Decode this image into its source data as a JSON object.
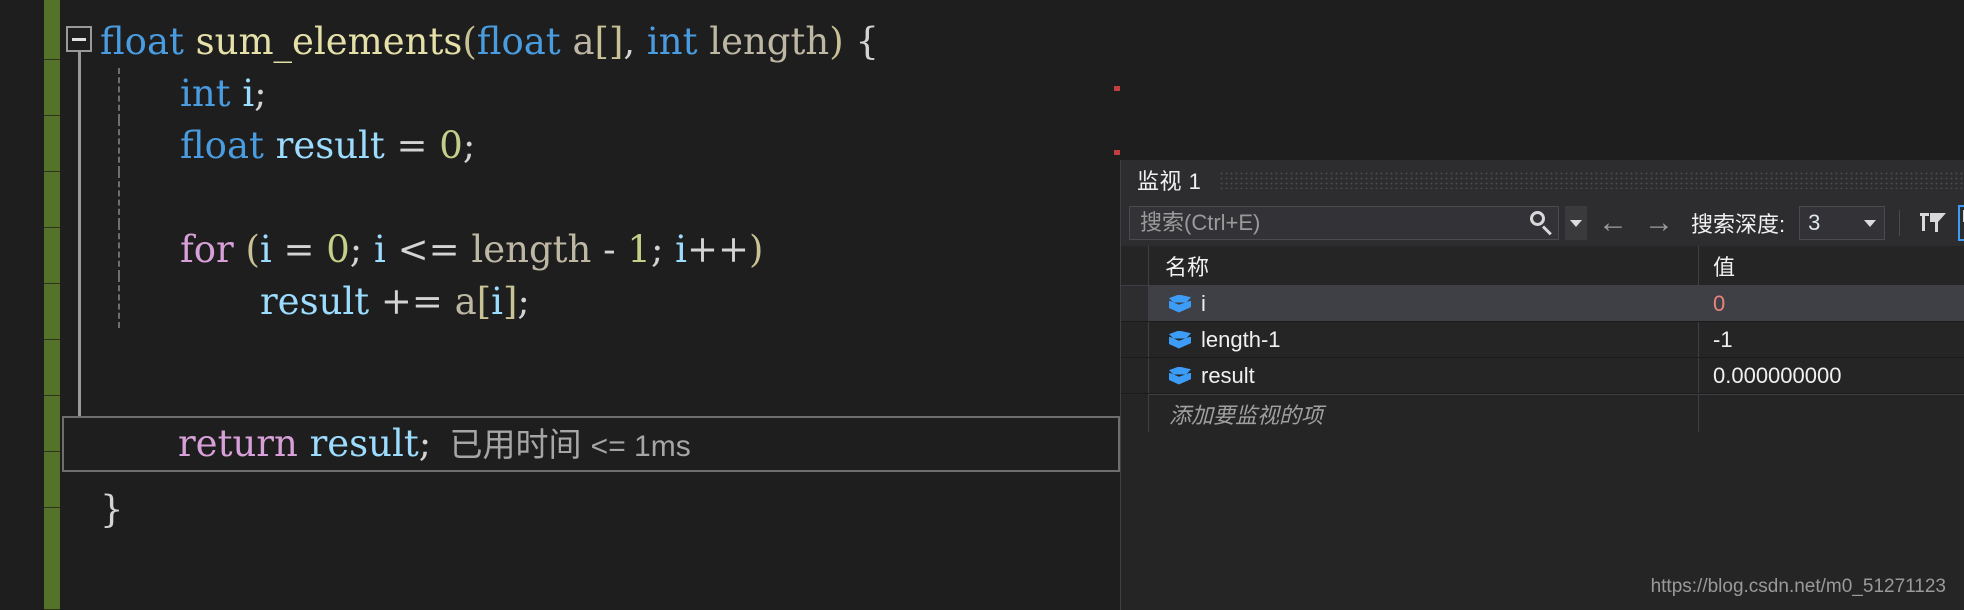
{
  "theme": {
    "editor_bg": "#1e1e1e",
    "panel_bg": "#252526",
    "toolbar_bg": "#2d2d30",
    "accent": "#3d9cf5",
    "change_bar": "#55722b",
    "changed_value": "#e9847c"
  },
  "editor": {
    "collapse_icon": "collapse-minus-icon",
    "lines": [
      {
        "id": "line-signature",
        "tokens": [
          {
            "t": "float",
            "c": "kw"
          },
          {
            "t": " ",
            "c": "punct"
          },
          {
            "t": "sum_elements",
            "c": "fn"
          },
          {
            "t": "(",
            "c": "brkt"
          },
          {
            "t": "float",
            "c": "kw"
          },
          {
            "t": " ",
            "c": "punct"
          },
          {
            "t": "a",
            "c": "param"
          },
          {
            "t": "[]",
            "c": "brkt"
          },
          {
            "t": ", ",
            "c": "punct"
          },
          {
            "t": "int",
            "c": "kw"
          },
          {
            "t": " ",
            "c": "punct"
          },
          {
            "t": "length",
            "c": "param"
          },
          {
            "t": ")",
            "c": "brkt"
          },
          {
            "t": " {",
            "c": "punct"
          }
        ]
      },
      {
        "id": "line-decl-i",
        "indent": 1,
        "tokens": [
          {
            "t": "int",
            "c": "kw"
          },
          {
            "t": " ",
            "c": "punct"
          },
          {
            "t": "i",
            "c": "var"
          },
          {
            "t": ";",
            "c": "punct"
          }
        ]
      },
      {
        "id": "line-decl-result",
        "indent": 1,
        "tokens": [
          {
            "t": "float",
            "c": "kw"
          },
          {
            "t": " ",
            "c": "punct"
          },
          {
            "t": "result",
            "c": "var"
          },
          {
            "t": " = ",
            "c": "punct"
          },
          {
            "t": "0",
            "c": "num"
          },
          {
            "t": ";",
            "c": "punct"
          }
        ]
      },
      {
        "id": "line-blank",
        "indent": 1,
        "tokens": []
      },
      {
        "id": "line-for",
        "indent": 1,
        "tokens": [
          {
            "t": "for",
            "c": "ctrl"
          },
          {
            "t": " ",
            "c": "punct"
          },
          {
            "t": "(",
            "c": "brkt"
          },
          {
            "t": "i",
            "c": "var"
          },
          {
            "t": " = ",
            "c": "punct"
          },
          {
            "t": "0",
            "c": "num"
          },
          {
            "t": "; ",
            "c": "punct"
          },
          {
            "t": "i",
            "c": "var"
          },
          {
            "t": " <= ",
            "c": "punct"
          },
          {
            "t": "length",
            "c": "param"
          },
          {
            "t": " - ",
            "c": "punct"
          },
          {
            "t": "1",
            "c": "num"
          },
          {
            "t": "; ",
            "c": "punct"
          },
          {
            "t": "i",
            "c": "var"
          },
          {
            "t": "++",
            "c": "punct"
          },
          {
            "t": ")",
            "c": "brkt"
          }
        ]
      },
      {
        "id": "line-accumulate",
        "indent": 2,
        "tokens": [
          {
            "t": "result",
            "c": "var"
          },
          {
            "t": " += ",
            "c": "punct"
          },
          {
            "t": "a",
            "c": "param"
          },
          {
            "t": "[",
            "c": "brkt"
          },
          {
            "t": "i",
            "c": "var"
          },
          {
            "t": "]",
            "c": "brkt"
          },
          {
            "t": ";",
            "c": "punct"
          }
        ]
      }
    ],
    "current_line": {
      "id": "line-return",
      "tokens": [
        {
          "t": "return",
          "c": "ctrl"
        },
        {
          "t": " ",
          "c": "punct"
        },
        {
          "t": "result",
          "c": "var"
        },
        {
          "t": ";",
          "c": "punct"
        }
      ],
      "elapsed_label": "已用时间",
      "elapsed_value": "<= 1ms"
    },
    "closing_brace": "}"
  },
  "watch": {
    "title": "监视 1",
    "search": {
      "placeholder": "搜索(Ctrl+E)",
      "value": "",
      "icon": "search-icon",
      "dropdown_icon": "chevron-down-icon"
    },
    "nav": {
      "prev_icon": "arrow-left-icon",
      "prev_label": "←",
      "next_icon": "arrow-right-icon",
      "next_label": "→"
    },
    "depth": {
      "label": "搜索深度:",
      "value": "3",
      "dropdown_icon": "chevron-down-icon"
    },
    "toolbar_icons": [
      {
        "name": "pin-filter-icon",
        "active": false
      },
      {
        "name": "hex-label-icon",
        "active": true
      }
    ],
    "columns": {
      "name": "名称",
      "value": "值"
    },
    "rows": [
      {
        "icon": "variable-cube-icon",
        "name": "i",
        "value": "0",
        "selected": true,
        "changed": true
      },
      {
        "icon": "variable-cube-icon",
        "name": "length-1",
        "value": "-1",
        "selected": false,
        "changed": false
      },
      {
        "icon": "variable-cube-icon",
        "name": "result",
        "value": "0.000000000",
        "selected": false,
        "changed": false
      }
    ],
    "add_placeholder": "添加要监视的项"
  },
  "watermark": "https://blog.csdn.net/m0_51271123"
}
